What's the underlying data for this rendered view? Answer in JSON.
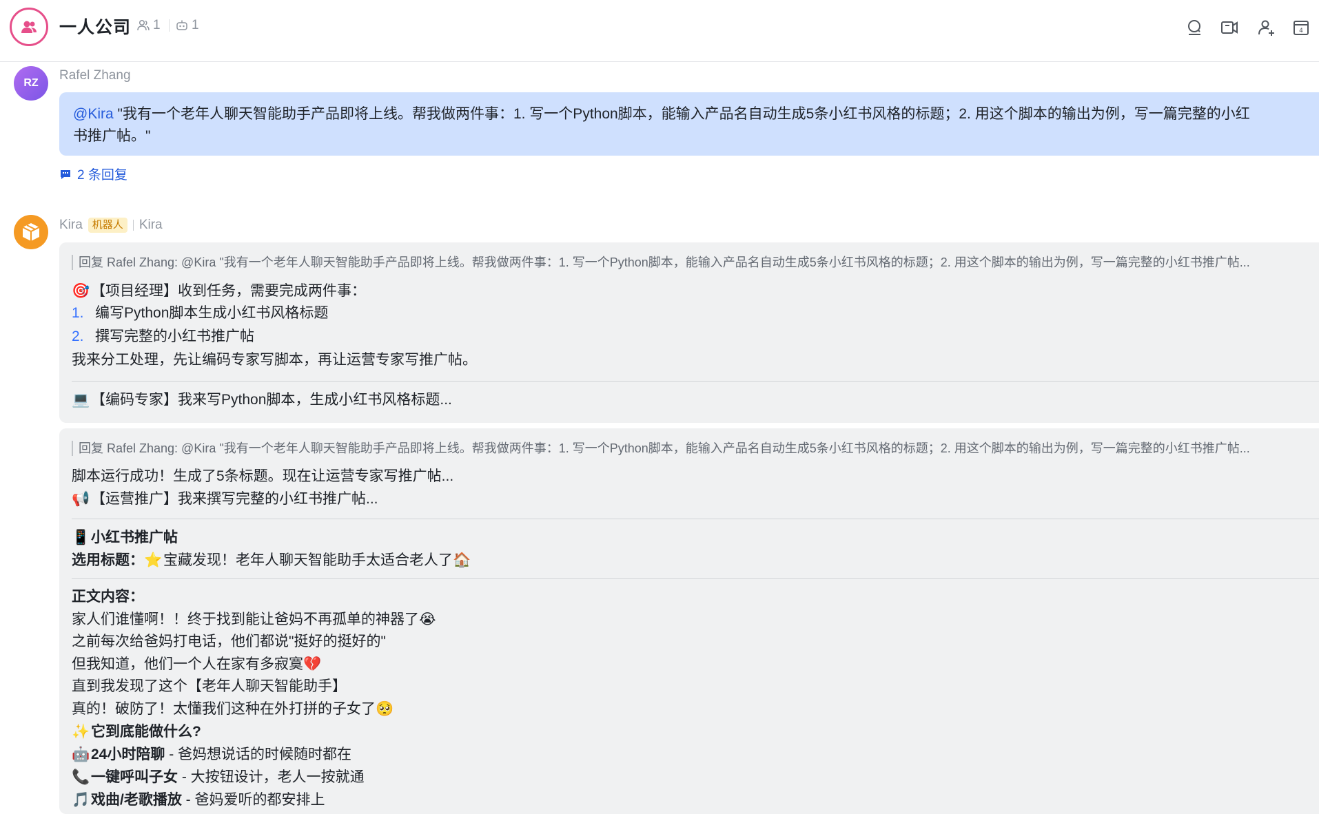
{
  "header": {
    "title": "一人公司",
    "member_count": "1",
    "bot_count": "1"
  },
  "message1": {
    "sender": "Rafel Zhang",
    "avatar_initials": "RZ",
    "mention": "@Kira",
    "text_line1": " \"我有一个老年人聊天智能助手产品即将上线。帮我做两件事：1. 写一个Python脚本，能输入产品名自动生成5条小红书风格的标题；2. 用这个脚本的输出为例，写一篇完整的小红",
    "text_line2": "书推广帖。\"",
    "reply_link": "2 条回复"
  },
  "message2": {
    "sender": "Kira",
    "badge": "机器人",
    "alias": "Kira",
    "quote": "回复 Rafel Zhang: @Kira \"我有一个老年人聊天智能助手产品即将上线。帮我做两件事：1. 写一个Python脚本，能输入产品名自动生成5条小红书风格的标题；2. 用这个脚本的输出为例，写一篇完整的小红书推广帖...",
    "pm_line": "【项目经理】收到任务，需要完成两件事：",
    "items": [
      {
        "num": "1.",
        "text": "编写Python脚本生成小红书风格标题"
      },
      {
        "num": "2.",
        "text": "撰写完整的小红书推广帖"
      }
    ],
    "plan_line": "我来分工处理，先让编码专家写脚本，再让运营专家写推广帖。",
    "coder_line": "【编码专家】我来写Python脚本，生成小红书风格标题..."
  },
  "message3": {
    "quote": "回复 Rafel Zhang: @Kira \"我有一个老年人聊天智能助手产品即将上线。帮我做两件事：1. 写一个Python脚本，能输入产品名自动生成5条小红书风格的标题；2. 用这个脚本的输出为例，写一篇完整的小红书推广帖...",
    "success_line": "脚本运行成功！生成了5条标题。现在让运营专家写推广帖...",
    "ops_line": "【运营推广】我来撰写完整的小红书推广帖...",
    "post_heading": "小红书推广帖",
    "title_label": "选用标题：",
    "title_value": "宝藏发现！老年人聊天智能助手太适合老人了",
    "body_label": "正文内容：",
    "body_lines": [
      "家人们谁懂啊！！终于找到能让爸妈不再孤单的神器了",
      "之前每次给爸妈打电话，他们都说\"挺好的挺好的\"",
      "但我知道，他们一个人在家有多寂寞",
      "直到我发现了这个【老年人聊天智能助手】",
      "真的！破防了！太懂我们这种在外打拼的子女了"
    ],
    "features_heading": "它到底能做什么?",
    "features": [
      {
        "bold": "24小时陪聊",
        "rest": " - 爸妈想说话的时候随时都在"
      },
      {
        "bold": "一键呼叫子女",
        "rest": " - 大按钮设计，老人一按就通"
      },
      {
        "bold": "戏曲/老歌播放",
        "rest": " - 爸妈爱听的都安排上"
      }
    ]
  },
  "colors": {
    "accent": "#245bdb",
    "user_bubble": "#cfe0fe",
    "bot_card": "#f0f1f2",
    "bot_badge_bg": "#fdf0c6",
    "group_ring": "#e64f8a"
  }
}
